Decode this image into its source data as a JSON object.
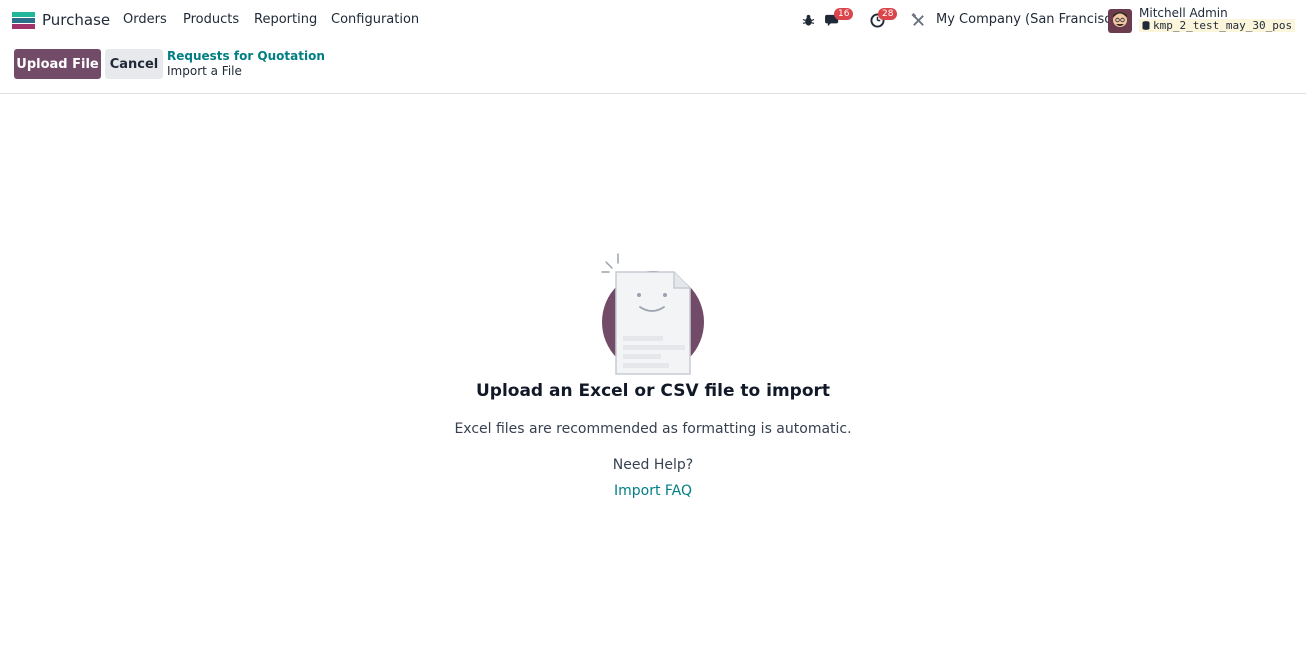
{
  "navbar": {
    "app_name": "Purchase",
    "menu": [
      "Orders",
      "Products",
      "Reporting",
      "Configuration"
    ],
    "messages_count": "16",
    "activities_count": "28",
    "company": "My Company (San Francisco)",
    "user_name": "Mitchell Admin",
    "database": "kmp_2_test_may_30_pos"
  },
  "control_panel": {
    "upload_label": "Upload File",
    "cancel_label": "Cancel",
    "breadcrumb_parent": "Requests for Quotation",
    "breadcrumb_current": "Import a File"
  },
  "main": {
    "title": "Upload an Excel or CSV file to import",
    "subtitle": "Excel files are recommended as formatting is automatic.",
    "help_text": "Need Help?",
    "faq_link": "Import FAQ"
  },
  "colors": {
    "brand": "#714b67",
    "link": "#017e84",
    "badge": "#d9454a"
  }
}
